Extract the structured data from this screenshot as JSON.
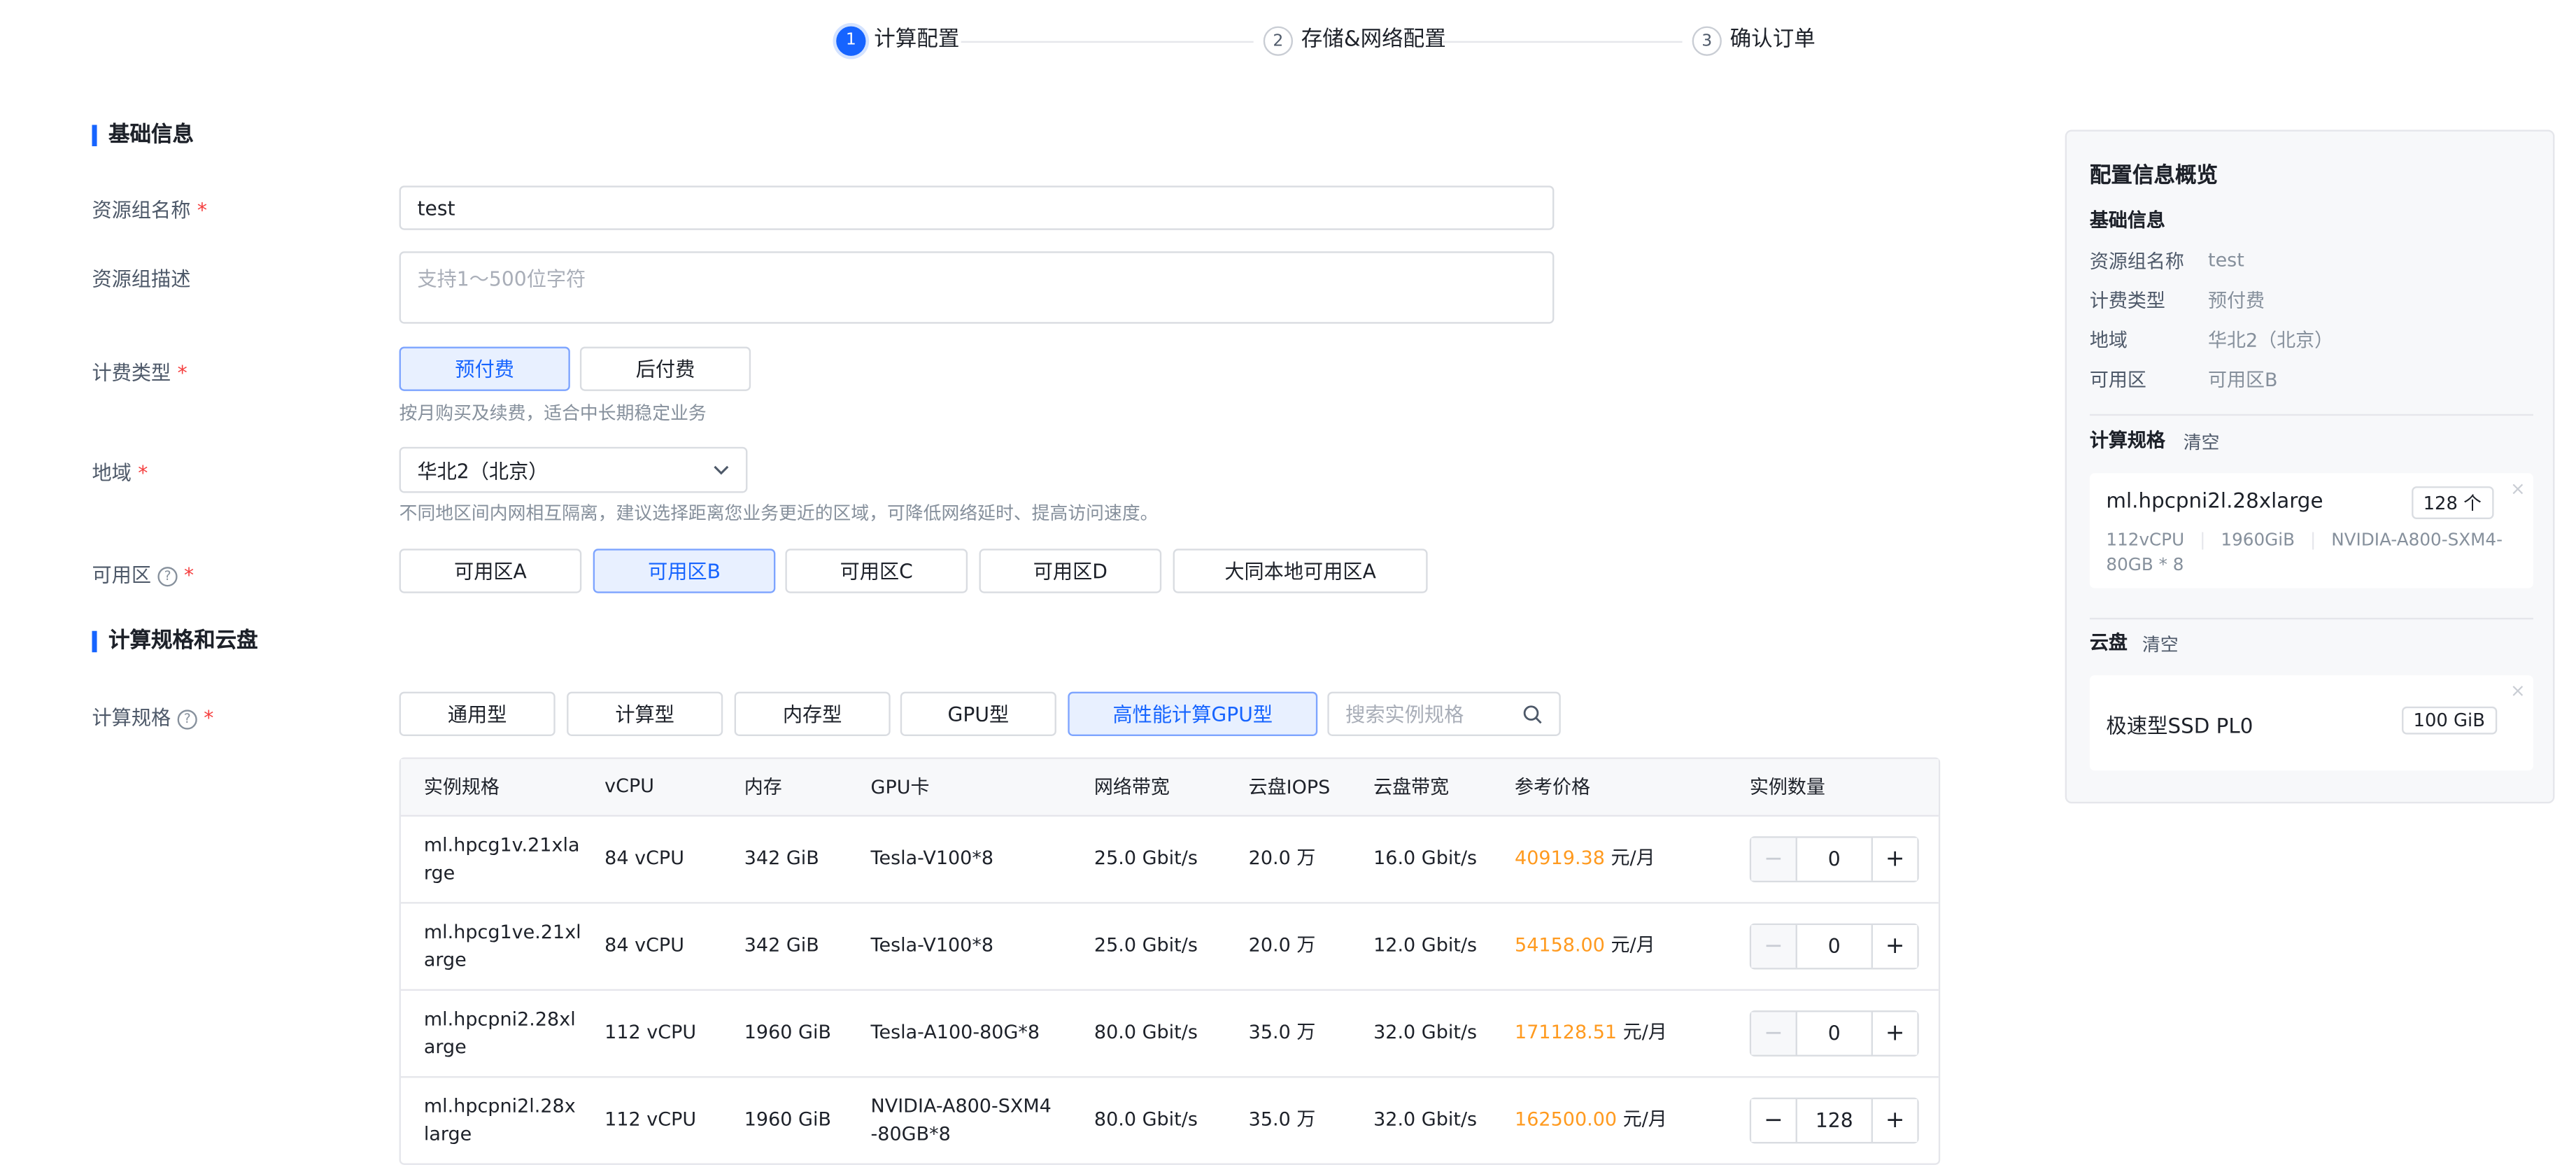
{
  "steps": [
    {
      "num": "1",
      "label": "计算配置"
    },
    {
      "num": "2",
      "label": "存储&网络配置"
    },
    {
      "num": "3",
      "label": "确认订单"
    }
  ],
  "sections": {
    "basic": "基础信息",
    "compute": "计算规格和云盘"
  },
  "form": {
    "name_label": "资源组名称",
    "name_value": "test",
    "desc_label": "资源组描述",
    "desc_placeholder": "支持1～500位字符",
    "billing_label": "计费类型",
    "billing_options": [
      "预付费",
      "后付费"
    ],
    "billing_hint": "按月购买及续费，适合中长期稳定业务",
    "region_label": "地域",
    "region_value": "华北2（北京）",
    "region_hint": "不同地区间内网相互隔离，建议选择距离您业务更近的区域，可降低网络延时、提高访问速度。",
    "zone_label": "可用区",
    "zones": [
      "可用区A",
      "可用区B",
      "可用区C",
      "可用区D",
      "大同本地可用区A"
    ],
    "spec_label": "计算规格",
    "spec_types": [
      "通用型",
      "计算型",
      "内存型",
      "GPU型",
      "高性能计算GPU型"
    ],
    "spec_search_placeholder": "搜索实例规格",
    "required_mark": "*",
    "help_mark": "?"
  },
  "table": {
    "headers": [
      "实例规格",
      "vCPU",
      "内存",
      "GPU卡",
      "网络带宽",
      "云盘IOPS",
      "云盘带宽",
      "参考价格",
      "实例数量"
    ],
    "price_unit": "元/月",
    "rows": [
      {
        "spec_l1": "ml.hpcg1v.21xla",
        "spec_l2": "rge",
        "vcpu": "84 vCPU",
        "mem": "342 GiB",
        "gpu_l1": "Tesla-V100*8",
        "gpu_l2": "",
        "net": "25.0 Gbit/s",
        "iops": "20.0 万",
        "bw": "16.0 Gbit/s",
        "price": "40919.38",
        "qty": "0"
      },
      {
        "spec_l1": "ml.hpcg1ve.21xl",
        "spec_l2": "arge",
        "vcpu": "84 vCPU",
        "mem": "342 GiB",
        "gpu_l1": "Tesla-V100*8",
        "gpu_l2": "",
        "net": "25.0 Gbit/s",
        "iops": "20.0 万",
        "bw": "12.0 Gbit/s",
        "price": "54158.00",
        "qty": "0"
      },
      {
        "spec_l1": "ml.hpcpni2.28xl",
        "spec_l2": "arge",
        "vcpu": "112 vCPU",
        "mem": "1960 GiB",
        "gpu_l1": "Tesla-A100-80G*8",
        "gpu_l2": "",
        "net": "80.0 Gbit/s",
        "iops": "35.0 万",
        "bw": "32.0 Gbit/s",
        "price": "171128.51",
        "qty": "0"
      },
      {
        "spec_l1": "ml.hpcpni2l.28x",
        "spec_l2": "large",
        "vcpu": "112 vCPU",
        "mem": "1960 GiB",
        "gpu_l1": "NVIDIA-A800-SXM4",
        "gpu_l2": "-80GB*8",
        "net": "80.0 Gbit/s",
        "iops": "35.0 万",
        "bw": "32.0 Gbit/s",
        "price": "162500.00",
        "qty": "128"
      }
    ]
  },
  "summary": {
    "title": "配置信息概览",
    "basic_title": "基础信息",
    "items": [
      {
        "key": "资源组名称",
        "val": "test"
      },
      {
        "key": "计费类型",
        "val": "预付费"
      },
      {
        "key": "地域",
        "val": "华北2（北京）"
      },
      {
        "key": "可用区",
        "val": "可用区B"
      }
    ],
    "compute_title": "计算规格",
    "clear": "清空",
    "compute_card": {
      "name": "ml.hpcpni2l.28xlarge",
      "count": "128 个",
      "detail1": "112vCPU",
      "detail2": "1960GiB",
      "detail3": "NVIDIA-A800-SXM4-",
      "detail4": "80GB * 8"
    },
    "disk_title": "云盘",
    "disk_card": {
      "name": "极速型SSD PL0",
      "size": "100 GiB"
    }
  },
  "colors": {
    "primary": "#1664ff",
    "price": "#ff9a1f",
    "required": "#f53f3f"
  }
}
